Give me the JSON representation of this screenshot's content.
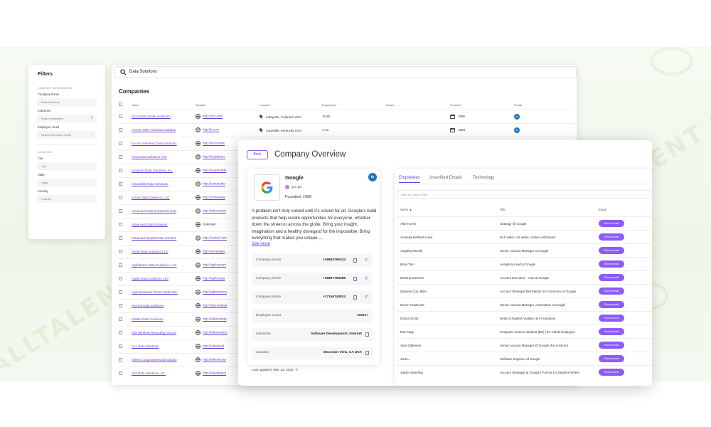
{
  "filters": {
    "title": "Filters",
    "section_company": "COMPANY INFORMATION",
    "company_name_label": "Company Name",
    "company_name_value": "Data Solutions",
    "industries_label": "Industries",
    "industries_placeholder": "Search industries",
    "employee_count_label": "Employee count",
    "employee_count_placeholder": "Search employee count",
    "section_location": "LOCATION",
    "city_label": "City",
    "city_placeholder": "City",
    "state_label": "State",
    "state_placeholder": "State",
    "country_label": "Country",
    "country_placeholder": "Country"
  },
  "search": {
    "value": "Data Solutions"
  },
  "companies": {
    "title": "Companies",
    "columns": [
      "Name",
      "Website",
      "Location",
      "Employees",
      "Saved",
      "Founded",
      "Social"
    ],
    "rows": [
      {
        "name": "ACU Data Center Solutions",
        "website": "http://dcs.com",
        "location": "Lafayette, Colorado USA",
        "employees": "11-50",
        "founded": "1995",
        "social": "in"
      },
      {
        "name": "Access Web And Data Solution",
        "website": "http://a.com",
        "location": "Louisville, Kentucky USA",
        "employees": "1-10",
        "founded": "1983",
        "social": "in"
      },
      {
        "name": "Access Wireless Data Solutions",
        "website": "http://accesswir"
      },
      {
        "name": "ACQ Data Solutions LTD",
        "website": "http://acqdataso"
      },
      {
        "name": "Acquired Data Solutions, Inc.",
        "website": "http://acquiredda"
      },
      {
        "name": "Actionable Data Solutions",
        "website": "http://actionable"
      },
      {
        "name": "Active Data Solutions, LLC",
        "website": "http://activedata"
      },
      {
        "name": "Advanced Data & Network Solu",
        "website": "http://advnetsolu"
      },
      {
        "name": "Advanced Data Solutions",
        "website": "Unknown"
      },
      {
        "name": "Advanced Spatial Data Solution",
        "website": "http://asdsol.com"
      },
      {
        "name": "Aerial Data Solutions LLC",
        "website": "http://aerialdata"
      },
      {
        "name": "Agilistream Data Solutions, LLC",
        "website": "http://agilistream"
      },
      {
        "name": "Agility Data Solutions LTD",
        "website": "http://agilitydata"
      },
      {
        "name": "Agile Business Driven Data Solu",
        "website": "http://agilebusine"
      },
      {
        "name": "Aksmat Data Solutions",
        "website": "http://aksmatdata"
      },
      {
        "name": "Alfabet Data Solutions",
        "website": "http://alfabetdata"
      },
      {
        "name": "Alfa Wireless Recycling And Da",
        "website": "http://alfawireless"
      },
      {
        "name": "ALL Data Solutions",
        "website": "http://alldatasol"
      },
      {
        "name": "Allient Cooperative Data Solutio",
        "website": "http://allientcoop"
      },
      {
        "name": "Alta Data Solutions, Inc.",
        "website": "http://altadatasol"
      }
    ]
  },
  "overview": {
    "back_label": "Back",
    "title": "Company Overview",
    "company_name": "Google",
    "domain": "goo.gle",
    "founded": "Founded: 1998",
    "social": "in",
    "description": "A problem isn't truly solved until it's solved for all. Googlers build products that help create opportunities for everyone, whether down the street or across the globe. Bring your insight, imagination and a healthy disregard for the impossible. Bring everything that makes you unique....",
    "see_more": "See more",
    "rows": [
      {
        "label": "Company phone",
        "value": "+18683765234"
      },
      {
        "label": "Company phone",
        "value": "+18687756389"
      },
      {
        "label": "Company phone",
        "value": "+17156743814"
      },
      {
        "label": "Employee Count",
        "value": "10001+"
      },
      {
        "label": "Industries",
        "value": "Software Development, Internet"
      },
      {
        "label": "Location",
        "value": "Mountain View, CA USA"
      }
    ],
    "last_updated": "Last updated: Mar 13, 2023"
  },
  "employees": {
    "tabs": [
      "Employees",
      "Unverified Emails",
      "Technology"
    ],
    "filter_placeholder": "Filter by name or title",
    "col_name": "Name ▲",
    "col_title": "Title",
    "col_email": "Email",
    "show_email_label": "Show email",
    "rows": [
      {
        "name": "Allie Turner",
        "title": "Strategy @ Google"
      },
      {
        "name": "Amanda Kirkland-Lowe",
        "title": "tech writer, UX writer, content enthusiast"
      },
      {
        "name": "Angelina Morelli",
        "title": "Senior Account Manager at Google"
      },
      {
        "name": "Brian Tam",
        "title": "Analytical Lead at Google"
      },
      {
        "name": "Brianna Danener",
        "title": "Account Executive - Auto at Google"
      },
      {
        "name": "Dallonte Cox, MBA",
        "title": "Account Strategist Mid Market, E-Commerce at Google"
      },
      {
        "name": "Devon Heathcote",
        "title": "Senior Account Manager, Automotive at Google"
      },
      {
        "name": "Donna Schut",
        "title": "Head of Applied Analytics & AI Solutions"
      },
      {
        "name": "Itam Nagi",
        "title": "Computer Science Student (BS) | Ex-Akerbi Employee"
      },
      {
        "name": "Jace Gittleman",
        "title": "Senior Account Manager @ Google (Ex-Amazon)"
      },
      {
        "name": "Jack L.",
        "title": "Software Engineer at Google"
      },
      {
        "name": "Jakob Heberling",
        "title": "Account Strategist at Google | Former D1 Student-Athlete"
      }
    ]
  },
  "colors": {
    "accent": "#8b5cf6",
    "link": "#6d3fcf",
    "linkedin": "#1b75bb",
    "watermark": "#78b450"
  }
}
